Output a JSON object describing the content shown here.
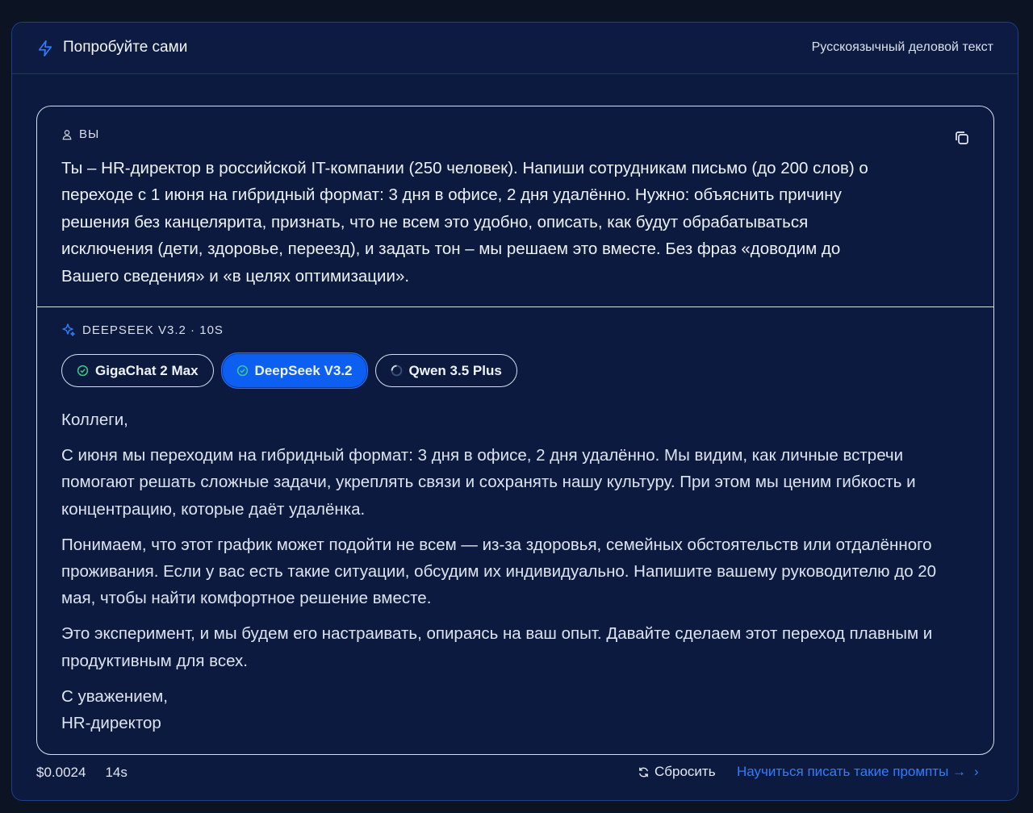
{
  "header": {
    "title": "Попробуйте сами",
    "subtitle": "Русскоязычный деловой текст"
  },
  "user": {
    "label": "ВЫ",
    "prompt": "Ты – HR-директор в российской IT-компании (250 человек). Напиши сотрудникам письмо (до 200 слов) о переходе с 1 июня на гибридный формат: 3 дня в офисе, 2 дня удалённо. Нужно: объяснить причину решения без канцелярита, признать, что не всем это удобно, описать, как будут обрабатываться исключения (дети, здоровье, переезд), и задать тон – мы решаем это вместе. Без фраз «доводим до Вашего сведения» и «в целях оптимизации»."
  },
  "response": {
    "label": "DEEPSEEK V3.2 · 10S",
    "models": [
      {
        "name": "GigaChat 2 Max",
        "status": "done"
      },
      {
        "name": "DeepSeek V3.2",
        "status": "done"
      },
      {
        "name": "Qwen 3.5 Plus",
        "status": "loading"
      }
    ],
    "active_model": "DeepSeek V3.2",
    "paragraphs": [
      "Коллеги,",
      "С июня мы переходим на гибридный формат: 3 дня в офисе, 2 дня удалённо. Мы видим, как личные встречи помогают решать сложные задачи, укреплять связи и сохранять нашу культуру. При этом мы ценим гибкость и концентрацию, которые даёт удалёнка.",
      "Понимаем, что этот график может подойти не всем — из-за здоровья, семейных обстоятельств или отдалённого проживания. Если у вас есть такие ситуации, обсудим их индивидуально. Напишите вашему руководителю до 20 мая, чтобы найти комфортное решение вместе.",
      "Это эксперимент, и мы будем его настраивать, опираясь на ваш опыт. Давайте сделаем этот переход плавным и продуктивным для всех."
    ],
    "signoff_line1": "С уважением,",
    "signoff_line2": "HR-директор"
  },
  "footer": {
    "cost": "$0.0024",
    "time": "14s",
    "reset_label": "Сбросить",
    "learn_label": "Научиться писать такие промпты →",
    "learn_chevron": "›"
  },
  "colors": {
    "accent": "#0c5ff0",
    "link": "#2f7cff",
    "background": "#0c1322",
    "card": "#0c1a3f",
    "success": "#3ec98a"
  }
}
